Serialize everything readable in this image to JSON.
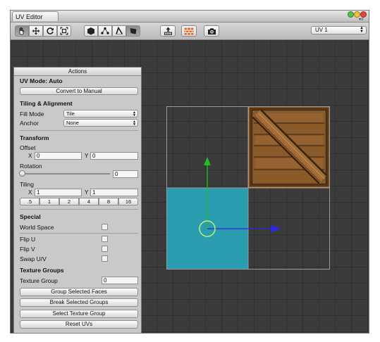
{
  "window": {
    "title": "UV Editor"
  },
  "toolbar": {
    "tools": [
      "hand-icon",
      "move-icon",
      "rotate-icon",
      "scale-icon",
      "face-icon",
      "vertex-icon",
      "edge-icon",
      "polygon-icon"
    ],
    "actions": [
      "export-icon",
      "texture-icon",
      "camera-icon"
    ],
    "uv_channel": "UV 1"
  },
  "actions": {
    "header": "Actions",
    "uv_mode": "UV Mode: Auto",
    "convert_button": "Convert to Manual",
    "tiling_title": "Tiling & Alignment",
    "fill_mode_label": "Fill Mode",
    "fill_mode_value": "Tile",
    "anchor_label": "Anchor",
    "anchor_value": "None",
    "transform_title": "Transform",
    "offset_label": "Offset",
    "offset_x_label": "X",
    "offset_x": "0",
    "offset_y_label": "Y",
    "offset_y": "0",
    "rotation_label": "Rotation",
    "rotation_value": "0",
    "rotation_fraction": 0,
    "tiling_label": "Tiling",
    "tiling_x_label": "X",
    "tiling_x": "1",
    "tiling_y_label": "Y",
    "tiling_y": "1",
    "tiling_presets": [
      ".5",
      "1",
      "2",
      "4",
      "8",
      "16"
    ],
    "special_title": "Special",
    "world_space_label": "World Space",
    "flip_u_label": "Flip U",
    "flip_v_label": "Flip V",
    "swap_uv_label": "Swap U/V",
    "texture_groups_title": "Texture Groups",
    "texture_group_label": "Texture Group",
    "texture_group_value": "0",
    "group_button": "Group Selected Faces",
    "break_button": "Break Selected Groups",
    "select_group_button": "Select Texture Group",
    "reset_button": "Reset UVs"
  },
  "colors": {
    "viewport_bg": "#3b3b3b",
    "selection_fill": "#2a9db0",
    "axis_y": "#1fc01f",
    "axis_x": "#2a2ae0",
    "pivot": "#b8f27a"
  }
}
